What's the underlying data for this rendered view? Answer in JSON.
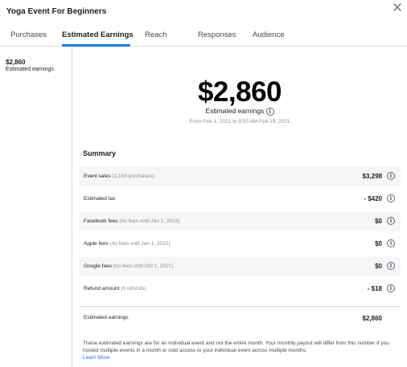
{
  "header": {
    "title": "Yoga Event For Beginners",
    "close_icon": "close-icon"
  },
  "tabs": [
    {
      "label": "Purchases",
      "active": false
    },
    {
      "label": "Estimated Earnings",
      "active": true
    },
    {
      "label": "Reach",
      "active": false
    },
    {
      "label": "Responses",
      "active": false
    },
    {
      "label": "Audience",
      "active": false
    }
  ],
  "sidebar": {
    "amount": "$2,860",
    "label": "Estimated earnings"
  },
  "hero": {
    "amount": "$2,860",
    "label": "Estimated earnings",
    "info_glyph": "i",
    "range": "From Feb 1, 2021 to 9:50 AM Feb 19, 2021"
  },
  "summary": {
    "title": "Summary",
    "rows": [
      {
        "label": "Event sales",
        "note": "(1,103 purchases)",
        "value": "$3,298"
      },
      {
        "label": "Estimated tax",
        "note": "",
        "value": "- $420"
      },
      {
        "label": "Facebook fees",
        "note": "(no fees until Jan 1, 2023)",
        "value": "$0"
      },
      {
        "label": "Apple fees",
        "note": "(no fees until Jan 1, 2022)",
        "value": "$0"
      },
      {
        "label": "Google fees",
        "note": "(no fees until Oct 1, 2021)",
        "value": "$0"
      },
      {
        "label": "Refund amount",
        "note": "(6 refunds)",
        "value": "- $18"
      }
    ],
    "total_label": "Estimated earnings",
    "total_value": "$2,860"
  },
  "footer": {
    "disclaimer": "These estimated earnings are for an individual event and not the entire month. Your monthly payout will differ from this number if you hosted multiple events in a month or sold access to your individual event across multiple months.",
    "learn_more": "Learn More"
  },
  "colors": {
    "accent": "#1877f2",
    "border": "#dadde1",
    "row_bg": "#f5f6f7",
    "muted": "#8a8d91"
  }
}
